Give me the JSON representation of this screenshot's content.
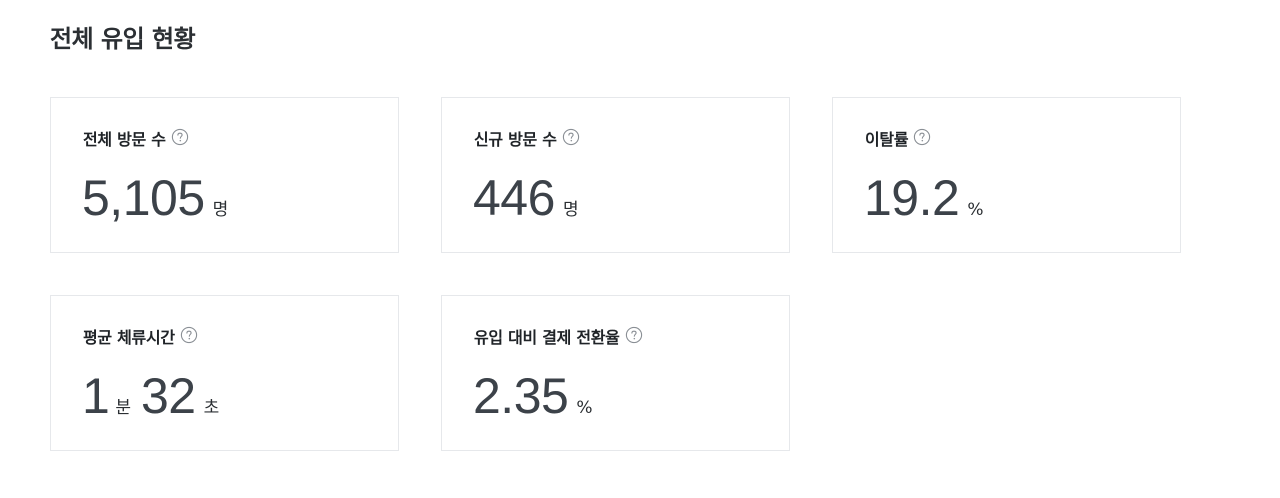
{
  "section": {
    "title": "전체 유입 현황"
  },
  "cards": [
    {
      "label": "전체 방문 수",
      "value": "5,105",
      "unit": "명",
      "help_icon": "question-circle-icon"
    },
    {
      "label": "신규 방문 수",
      "value": "446",
      "unit": "명",
      "help_icon": "question-circle-icon"
    },
    {
      "label": "이탈률",
      "value": "19.2",
      "unit": "%",
      "help_icon": "question-circle-icon"
    },
    {
      "label": "평균 체류시간",
      "minutes": "1",
      "minutes_unit": "분",
      "seconds": "32",
      "seconds_unit": "초",
      "help_icon": "question-circle-icon"
    },
    {
      "label": "유입 대비 결제 전환율",
      "value": "2.35",
      "unit": "%",
      "help_icon": "question-circle-icon"
    }
  ],
  "colors": {
    "title": "#2b2f33",
    "value": "#3c4249",
    "card_border": "#e6e8eb",
    "icon": "#8a8f95"
  }
}
